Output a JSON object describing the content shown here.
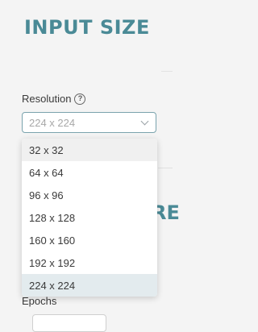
{
  "section": {
    "title": "INPUT SIZE"
  },
  "resolution": {
    "label": "Resolution",
    "help_symbol": "?",
    "value": "224 x 224",
    "options": [
      "32 x 32",
      "64 x 64",
      "96 x 96",
      "128 x 128",
      "160 x 160",
      "192 x 192",
      "224 x 224"
    ],
    "selected_index": 6,
    "hovered_index": 0
  },
  "background": {
    "next_heading_fragment": "RE",
    "next_field_label_fragment": "Epochs"
  },
  "colors": {
    "heading": "#4a8a96",
    "select_border": "#7aa3ad",
    "selected_option_bg": "#e3ebee"
  }
}
